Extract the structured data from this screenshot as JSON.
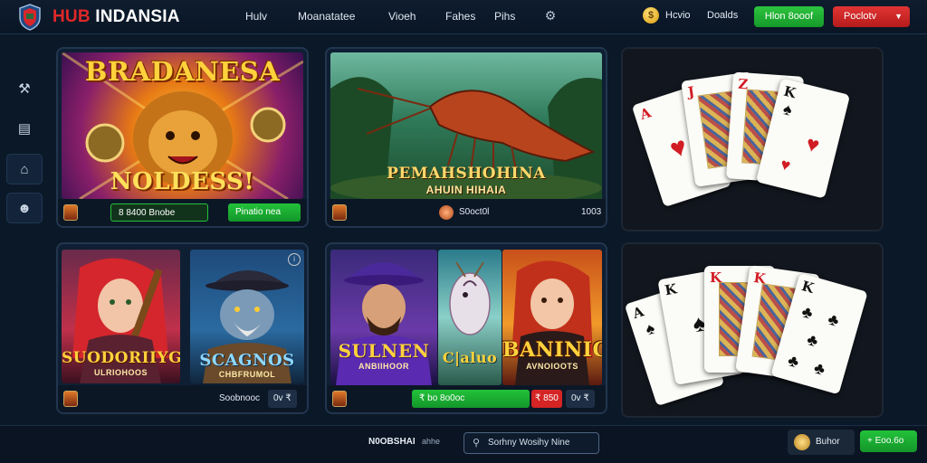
{
  "header": {
    "brand_main": "HUB",
    "brand_rest": " INDANSIA",
    "nav": [
      "Hulv",
      "Moanatatee",
      "Vioeh",
      "Fahes",
      "Pihs"
    ],
    "coin_label": "Hcvio",
    "account_label": "Doalds",
    "green_button": "Hlon 8ooof",
    "red_button": "Poclotv",
    "nav_icon": "controller-icon"
  },
  "sidebar": {
    "icons": [
      "tools-icon",
      "document-icon",
      "shop-icon",
      "profile-icon"
    ]
  },
  "cards": {
    "c1": {
      "title": "BRADANESA",
      "subtitle": "NOLDESS!",
      "bar_value": "8 8400 Bnobe",
      "bar_button": "Pinatio nea"
    },
    "c2": {
      "title": "PEMAHSHOHINA",
      "subtitle": "AHUIN HIHAIA",
      "bar_value": "S0oct0l",
      "bar_right": "1003"
    },
    "c4a": {
      "title": "SUODORIIYG",
      "subtitle": "ULRIOHOOS"
    },
    "c4b": {
      "title": "SCAGNOS",
      "subtitle": "CHBFRUMOL"
    },
    "c4_bar": {
      "value": "Soobnooc",
      "chip": "0v ₹"
    },
    "c5a": {
      "title": "SULNEN",
      "subtitle": "ANBIIHOOR"
    },
    "c5b": {
      "title": "C|aluo"
    },
    "c5c": {
      "title": "BANINIG",
      "subtitle": "AVNOIOOTS"
    },
    "c5_bar": {
      "value": "₹ bo 8o0oc",
      "red": "₹ 850",
      "chip": "0v ₹"
    }
  },
  "footer": {
    "left_text": "N0OBSHAI",
    "left_sub": "ahhe",
    "search_text": "Sorhny  Wosihy Nine",
    "right_text": "Buhor",
    "right_button": "Eoo.6o"
  },
  "colors": {
    "accent_green": "#22c23a",
    "accent_red": "#e02828",
    "background": "#0b1828"
  }
}
